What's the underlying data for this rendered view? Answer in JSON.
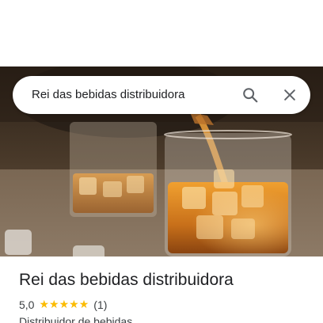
{
  "search": {
    "value": "Rei das bebidas distribuidora"
  },
  "place": {
    "name": "Rei das bebidas distribuidora",
    "rating": "5,0",
    "stars": [
      "★",
      "★",
      "★",
      "★",
      "★"
    ],
    "review_count": "(1)",
    "category": "Distribuidor de bebidas"
  },
  "icons": {
    "search": "search-icon",
    "close": "close-icon"
  },
  "colors": {
    "star": "#fbbc04",
    "text_primary": "#202124",
    "text_secondary": "#3c4043",
    "icon": "#5f6368"
  }
}
